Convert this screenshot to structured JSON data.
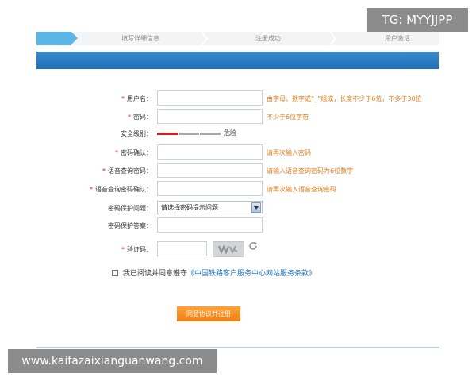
{
  "watermarks": {
    "top_right": "TG: MYYJJPP",
    "bottom_left": "www.kaifazaixianguanwang.com"
  },
  "steps": [
    {
      "label": "填写详细信息"
    },
    {
      "label": "注册成功"
    },
    {
      "label": "用户激活"
    }
  ],
  "form": {
    "required_mark": "*",
    "fields": [
      {
        "label": "用户名：",
        "hint": "由字母、数字或“_”组成，长度不少于6位，不多于30位",
        "value": ""
      },
      {
        "label": "密码：",
        "hint": "不少于6位字符",
        "value": ""
      },
      {
        "label": "密码确认：",
        "hint": "请再次输入密码",
        "value": ""
      },
      {
        "label": "语音查询密码：",
        "hint": "请输入语音查询密码为6位数字",
        "value": ""
      },
      {
        "label": "语音查询密码确认：",
        "hint": "请再次输入语音查询密码",
        "value": ""
      },
      {
        "label": "密码保护答案：",
        "value": ""
      },
      {
        "label": "验证码：",
        "value": ""
      }
    ],
    "security_level": {
      "label": "安全级别：",
      "text": "危险",
      "level": 1,
      "levels": 3,
      "color_active": "#cc1f1f",
      "color_inactive": "#a8a8a8"
    },
    "question": {
      "label": "密码保护问题：",
      "selected": "请选择密码提示问题"
    },
    "agree": {
      "prefix": "我已阅读并同意遵守",
      "link": "《中国铁路客户服务中心网站服务条款》",
      "checked": false
    },
    "submit_label": "同意协议并注册"
  },
  "icons": {
    "refresh": "refresh-icon",
    "captcha": "captcha-image",
    "select": "chevron-down-icon"
  },
  "colors": {
    "accent_blue": "#1f6fb8",
    "hint_orange": "#e07b1a",
    "submit_orange": "#f07d0c",
    "required_red": "#dd2222"
  }
}
